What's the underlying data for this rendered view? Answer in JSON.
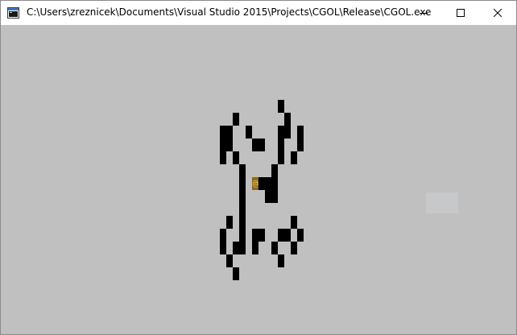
{
  "window": {
    "title": "C:\\Users\\zreznicek\\Documents\\Visual Studio 2015\\Projects\\CGOL\\Release\\CGOL.exe",
    "icon": "console-app-icon"
  },
  "controls": {
    "minimize_icon": "minimize-icon",
    "maximize_icon": "maximize-icon",
    "close_icon": "close-icon"
  },
  "colors": {
    "background": "#c0c0c0",
    "live_cell": "#000000",
    "cursor_bg": "#8c6a1e",
    "cursor_fg": "#f0c060"
  },
  "cursor": {
    "symbol": "@",
    "col": 39,
    "row": 12
  },
  "grid": {
    "live_cells": [
      [
        43,
        6
      ],
      [
        36,
        7
      ],
      [
        44,
        7
      ],
      [
        34,
        8
      ],
      [
        35,
        8
      ],
      [
        38,
        8
      ],
      [
        43,
        8
      ],
      [
        44,
        8
      ],
      [
        46,
        8
      ],
      [
        34,
        9
      ],
      [
        35,
        9
      ],
      [
        39,
        9
      ],
      [
        40,
        9
      ],
      [
        43,
        9
      ],
      [
        46,
        9
      ],
      [
        34,
        10
      ],
      [
        36,
        10
      ],
      [
        43,
        10
      ],
      [
        45,
        10
      ],
      [
        37,
        11
      ],
      [
        42,
        11
      ],
      [
        37,
        12
      ],
      [
        40,
        12
      ],
      [
        41,
        12
      ],
      [
        42,
        12
      ],
      [
        37,
        13
      ],
      [
        41,
        13
      ],
      [
        42,
        13
      ],
      [
        37,
        14
      ],
      [
        35,
        15
      ],
      [
        37,
        15
      ],
      [
        45,
        15
      ],
      [
        34,
        16
      ],
      [
        37,
        16
      ],
      [
        39,
        16
      ],
      [
        40,
        16
      ],
      [
        43,
        16
      ],
      [
        44,
        16
      ],
      [
        46,
        16
      ],
      [
        34,
        17
      ],
      [
        36,
        17
      ],
      [
        37,
        17
      ],
      [
        39,
        17
      ],
      [
        42,
        17
      ],
      [
        45,
        17
      ],
      [
        35,
        18
      ],
      [
        43,
        18
      ],
      [
        36,
        19
      ]
    ]
  }
}
